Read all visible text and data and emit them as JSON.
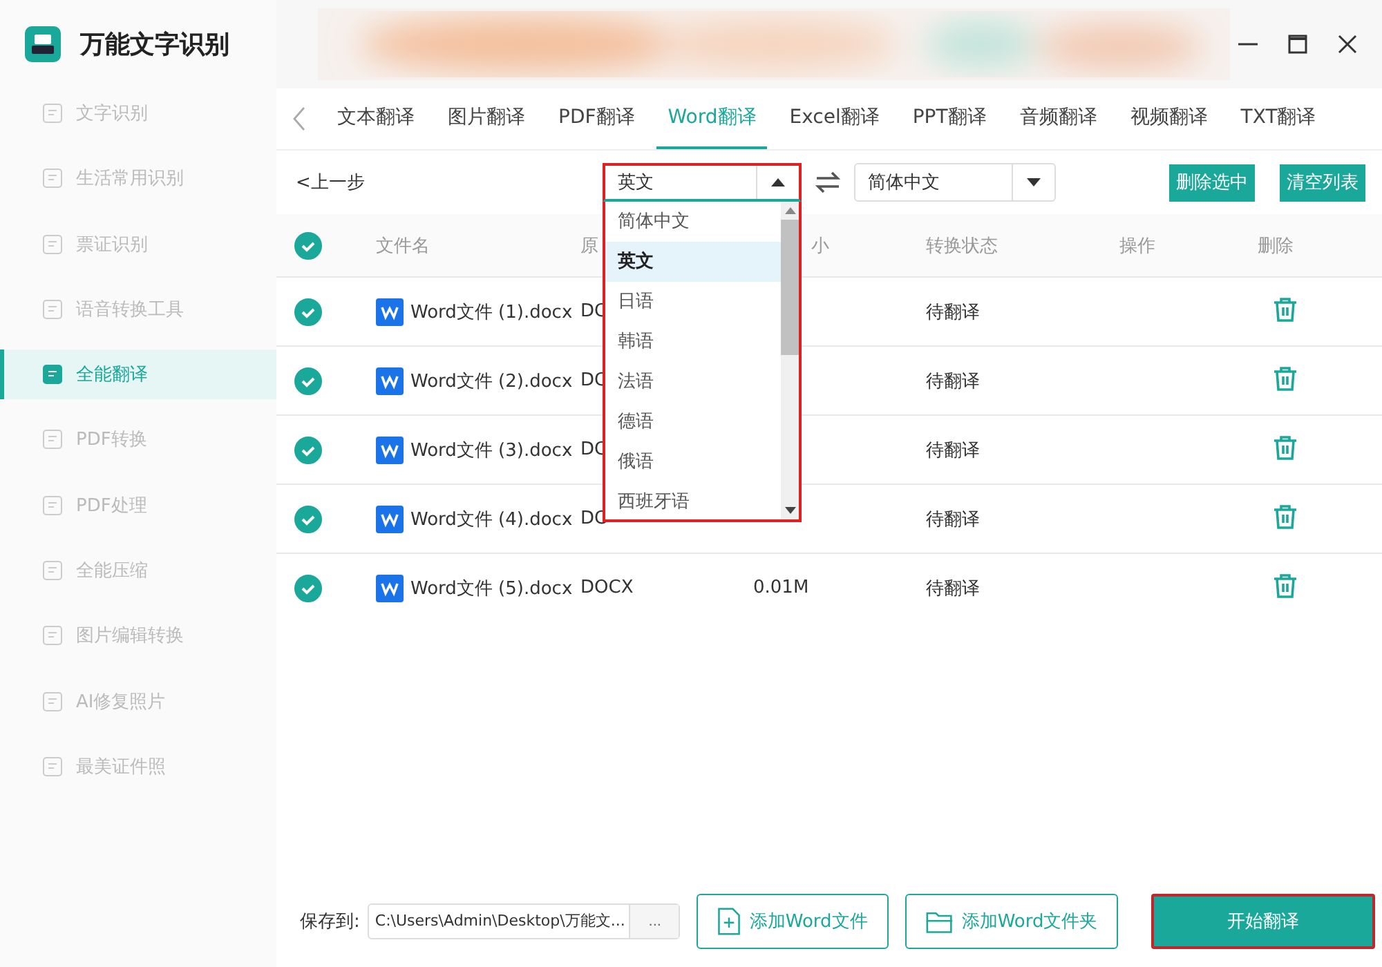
{
  "app": {
    "title": "万能文字识别"
  },
  "sidebar": {
    "items": [
      {
        "label": "文字识别",
        "selected": false
      },
      {
        "label": "生活常用识别",
        "selected": false
      },
      {
        "label": "票证识别",
        "selected": false
      },
      {
        "label": "语音转换工具",
        "selected": false
      },
      {
        "label": "全能翻译",
        "selected": true
      },
      {
        "label": "PDF转换",
        "selected": false
      },
      {
        "label": "PDF处理",
        "selected": false
      },
      {
        "label": "全能压缩",
        "selected": false
      },
      {
        "label": "图片编辑转换",
        "selected": false
      },
      {
        "label": "AI修复照片",
        "selected": false
      },
      {
        "label": "最美证件照",
        "selected": false
      }
    ]
  },
  "tabs": [
    {
      "label": "文本翻译",
      "selected": false
    },
    {
      "label": "图片翻译",
      "selected": false
    },
    {
      "label": "PDF翻译",
      "selected": false
    },
    {
      "label": "Word翻译",
      "selected": true
    },
    {
      "label": "Excel翻译",
      "selected": false
    },
    {
      "label": "PPT翻译",
      "selected": false
    },
    {
      "label": "音频翻译",
      "selected": false
    },
    {
      "label": "视频翻译",
      "selected": false
    },
    {
      "label": "TXT翻译",
      "selected": false
    }
  ],
  "toolbar": {
    "back": "<上一步",
    "source_language": {
      "value": "英文",
      "expanded": true,
      "options": [
        {
          "label": "简体中文",
          "selected": false
        },
        {
          "label": "英文",
          "selected": true
        },
        {
          "label": "日语",
          "selected": false
        },
        {
          "label": "韩语",
          "selected": false
        },
        {
          "label": "法语",
          "selected": false
        },
        {
          "label": "德语",
          "selected": false
        },
        {
          "label": "俄语",
          "selected": false
        },
        {
          "label": "西班牙语",
          "selected": false
        }
      ]
    },
    "target_language": {
      "value": "简体中文",
      "expanded": false
    },
    "buttons": [
      "删除选中",
      "清空列表"
    ]
  },
  "table": {
    "all_checked": true,
    "columns": [
      "文件名",
      "原",
      "小",
      "转换状态",
      "操作",
      "删除"
    ],
    "rows": [
      {
        "checked": true,
        "name": "Word文件 (1).docx",
        "format": "DC",
        "status": "待翻译"
      },
      {
        "checked": true,
        "name": "Word文件 (2).docx",
        "format": "DC",
        "status": "待翻译"
      },
      {
        "checked": true,
        "name": "Word文件 (3).docx",
        "format": "DC",
        "status": "待翻译"
      },
      {
        "checked": true,
        "name": "Word文件 (4).docx",
        "format": "DC",
        "status": "待翻译"
      },
      {
        "checked": true,
        "name": "Word文件 (5).docx",
        "format": "DOCX",
        "size": "0.01M",
        "status": "待翻译"
      }
    ]
  },
  "footer": {
    "save_label": "保存到:",
    "save_path": "C:\\Users\\Admin\\Desktop\\万能文...",
    "browse": "...",
    "add_file": "添加Word文件",
    "add_folder": "添加Word文件夹",
    "start": "开始翻译"
  }
}
